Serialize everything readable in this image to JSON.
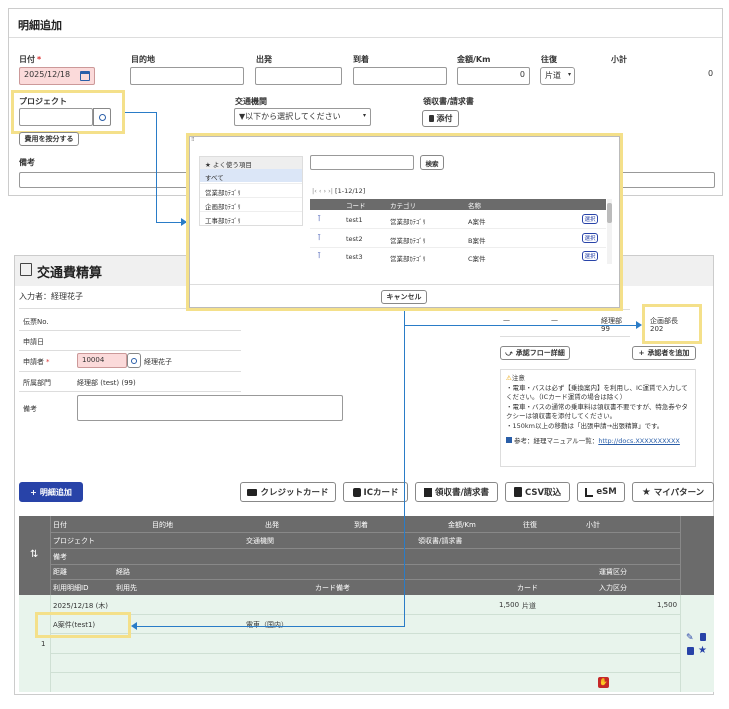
{
  "detail_form": {
    "title": "明細追加",
    "labels": {
      "date": "日付",
      "purpose": "目的地",
      "departure": "出発",
      "arrival": "到着",
      "amount": "金額/Km",
      "roundtrip": "往復",
      "subtotal": "小計",
      "project": "プロジェクト",
      "transport": "交通機関",
      "receipt": "領収書/請求書",
      "remarks": "備考",
      "required_mark": "*"
    },
    "date_value": "2025/12/18",
    "amount_value": "0",
    "roundtrip_value": "片道",
    "subtotal_value": "0",
    "transport_placeholder": "▼以下から選択してください",
    "attach_label": "添付",
    "copy_button": "費用を按分する"
  },
  "picker": {
    "left_items": [
      "よく使う項目",
      "すべて",
      "営業部ｶﾃｺﾞﾘ",
      "企画部ｶﾃｺﾞﾘ",
      "工事部ｶﾃｺﾞﾘ"
    ],
    "search_button": "検索",
    "pager": "[1-12/12]",
    "columns": [
      "コード",
      "カテゴリ",
      "名称"
    ],
    "rows": [
      {
        "code": "test1",
        "category": "営業部ｶﾃｺﾞﾘ",
        "name": "A案件",
        "select": "選択"
      },
      {
        "code": "test2",
        "category": "営業部ｶﾃｺﾞﾘ",
        "name": "B案件",
        "select": "選択"
      },
      {
        "code": "test3",
        "category": "営業部ｶﾃｺﾞﾘ",
        "name": "C案件",
        "select": "選択"
      }
    ],
    "cancel": "キャンセル"
  },
  "expense": {
    "title": "交通費精算",
    "entered_by": "入力者：経理花子",
    "fields": {
      "slip_no": "伝票No.",
      "apply_date": "申請日",
      "applicant": "申請者",
      "applicant_code": "10004",
      "applicant_name": "経理花子",
      "dept": "所属部門",
      "dept_value": "経理部 (test) (99)",
      "remarks": "備考"
    },
    "approval": {
      "dash1": "—",
      "dash2": "—",
      "dept": "経理部",
      "dept_code": "99",
      "manager": "企画部長",
      "manager_code": "202",
      "flow_detail": "承認フロー詳細",
      "add_approver": "承認者を追加"
    },
    "notice": {
      "title": "注意",
      "lines": [
        "・電車・バスは必ず【乗換案内】を利用し、IC運賃で入力して",
        "ください。（ICカード運賃の場合は除く）",
        "・電車・バスの通常の乗車料は領収書不要ですが、特急券やタ",
        "クシーは領収書を添付してください。",
        "・150km以上の移動は「出張申請→出張精算」です。"
      ],
      "ref_label": "参考：経理マニュアル一覧：",
      "ref_link": "http://docs.XXXXXXXXXX"
    },
    "toolbar": {
      "add_detail": "明細追加",
      "credit": "クレジットカード",
      "ic": "ICカード",
      "receipt": "領収書/請求書",
      "csv": "CSV取込",
      "esm": "eSM",
      "pattern": "マイパターン"
    },
    "table_headers": {
      "row1": [
        "日付",
        "目的地",
        "出発",
        "到着",
        "金額/Km",
        "往復",
        "小計"
      ],
      "row2": [
        "プロジェクト",
        "交通機関",
        "領収書/請求書"
      ],
      "row3": [
        "備考"
      ],
      "row4": [
        "距離",
        "経路",
        "運賃区分"
      ],
      "row5": [
        "利用明細ID",
        "利用先",
        "カード備考",
        "カード",
        "入力区分"
      ]
    },
    "row": {
      "index": "1",
      "date": "2025/12/18 (木)",
      "amount": "1,500",
      "roundtrip": "片道",
      "subtotal": "1,500",
      "project": "A案件(test1)",
      "transport": "電車（国内）"
    }
  }
}
